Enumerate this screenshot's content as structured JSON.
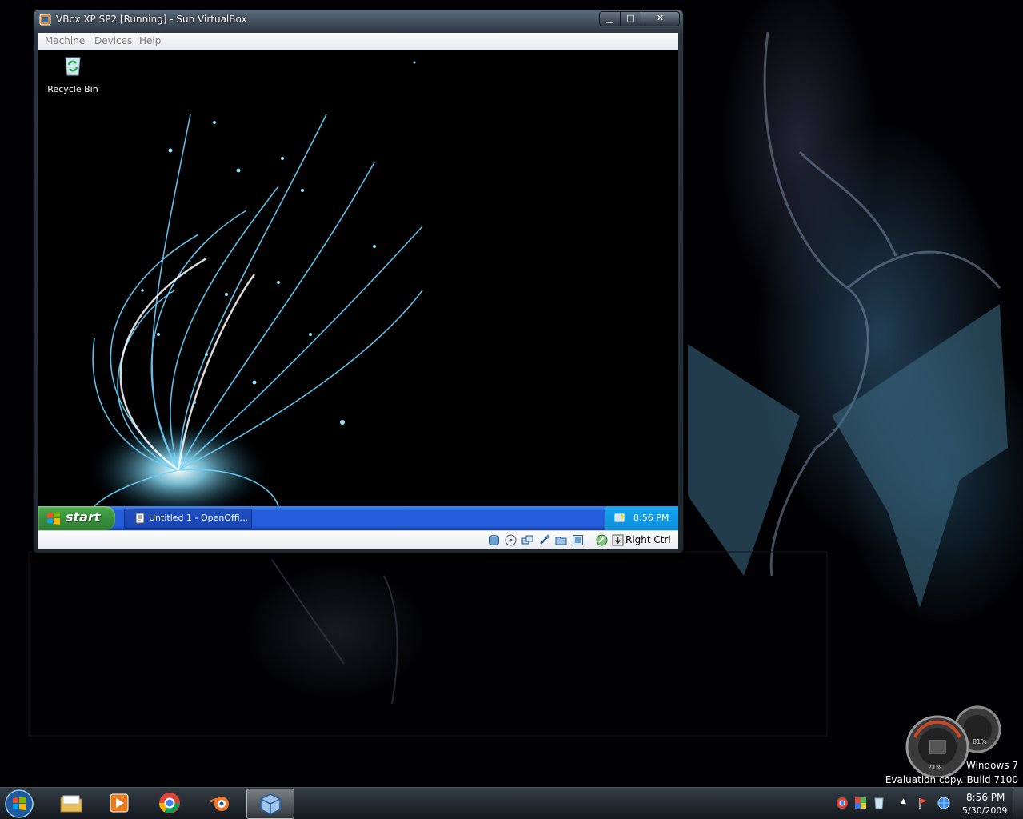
{
  "vbox": {
    "title": "VBox XP SP2 [Running] - Sun VirtualBox",
    "minimize": "▁",
    "maximize": "□",
    "close": "✕",
    "menu": [
      "Machine",
      "Devices",
      "Help"
    ],
    "host_key": "Right Ctrl"
  },
  "guest": {
    "recycle_bin_label": "Recycle Bin",
    "start_label": "start",
    "task_label": "Untitled 1 - OpenOffi...",
    "clock": "8:56 PM"
  },
  "host": {
    "watermark_line1": "Windows 7",
    "watermark_line2": "Evaluation copy. Build 7100",
    "clock_time": "8:56 PM",
    "clock_date": "5/30/2009",
    "gadget_cpu": "21%",
    "gadget_memory": "81%"
  },
  "colors": {
    "xp_taskbar": "#245edb",
    "xp_start": "#388e3c",
    "xp_tray": "#0d8dd8",
    "win7_taskbar": "#1e262e",
    "accent_glow": "#6ad4ff"
  },
  "icons": {
    "pinned": [
      "explorer-icon",
      "media-player-icon",
      "chrome-icon",
      "blender-icon",
      "virtualbox-icon"
    ],
    "tray": [
      "chrome-tray-icon",
      "colors-tray-icon",
      "recycle-tray-icon",
      "flag-icon",
      "network-icon"
    ],
    "vbox_status": [
      "hard-disk-icon",
      "cd-icon",
      "network-adapter-icon",
      "usb-icon",
      "shared-folder-icon",
      "vrdp-icon",
      "mouse-integration-icon",
      "host-key-icon"
    ]
  }
}
